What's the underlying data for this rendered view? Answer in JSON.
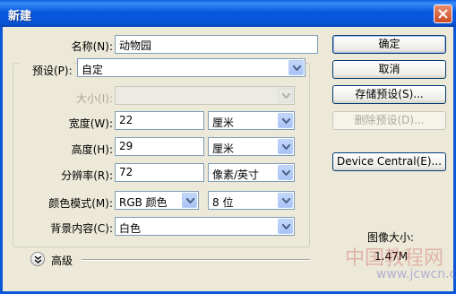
{
  "window": {
    "title": "新建"
  },
  "form": {
    "name_label": "名称(N):",
    "name_value": "动物园",
    "preset_label": "预设(P):",
    "preset_value": "自定",
    "size_label": "大小(I):",
    "width_label": "宽度(W):",
    "width_value": "22",
    "width_unit": "厘米",
    "height_label": "高度(H):",
    "height_value": "29",
    "height_unit": "厘米",
    "resolution_label": "分辨率(R):",
    "resolution_value": "72",
    "resolution_unit": "像素/英寸",
    "color_mode_label": "颜色模式(M):",
    "color_mode_value": "RGB 颜色",
    "bit_depth_value": "8 位",
    "background_label": "背景内容(C):",
    "background_value": "白色",
    "advanced_label": "高级"
  },
  "buttons": {
    "ok": "确定",
    "cancel": "取消",
    "save_preset": "存储预设(S)...",
    "delete_preset": "删除预设(D)...",
    "device_central": "Device Central(E)..."
  },
  "info": {
    "image_size_label": "图像大小:",
    "image_size_value": "1.47M"
  },
  "watermark": {
    "text": "中国教程网",
    "url": "www.jcwcn.com"
  }
}
